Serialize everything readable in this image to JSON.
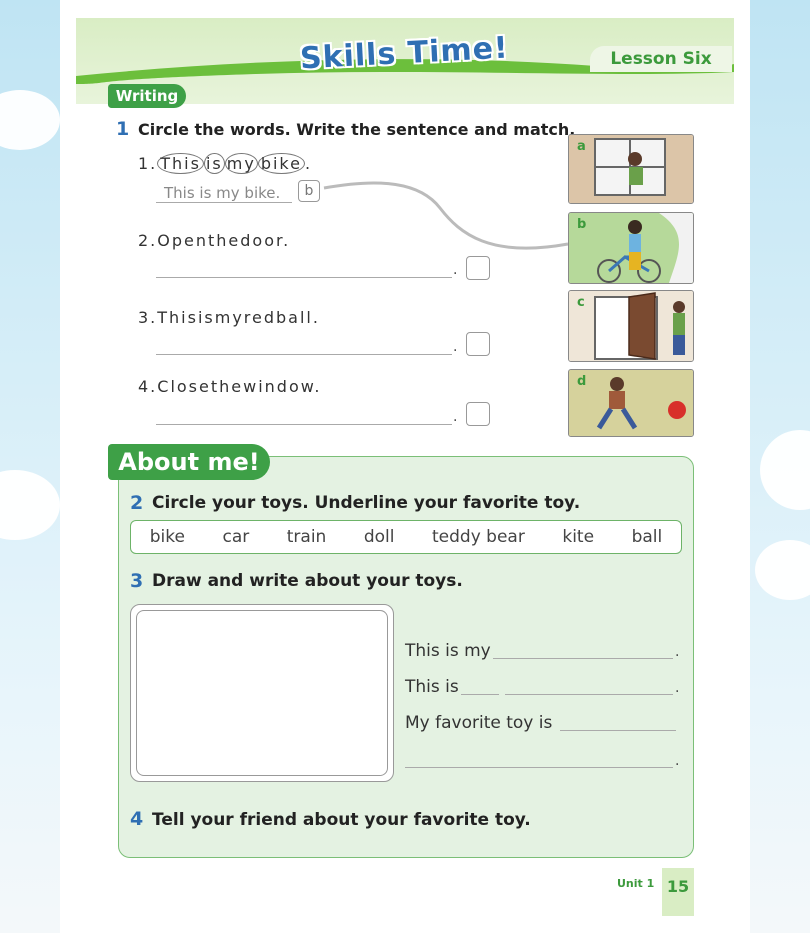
{
  "header": {
    "title": "Skills Time!",
    "lesson": "Lesson Six",
    "section_badge": "Writing"
  },
  "q1": {
    "number": "1",
    "instruction": "Circle the words. Write the sentence and match.",
    "items": [
      {
        "num": "1.",
        "words": [
          "This",
          "is",
          "my",
          "bike"
        ],
        "end": ".",
        "answer": "This is my bike.",
        "match": "b"
      },
      {
        "num": "2.",
        "text": "Openthedoor."
      },
      {
        "num": "3.",
        "text": "Thisismyredball."
      },
      {
        "num": "4.",
        "text": "Closethewindow."
      }
    ],
    "pictures": [
      "a",
      "b",
      "c",
      "d"
    ]
  },
  "about": {
    "badge": "About me!"
  },
  "q2": {
    "number": "2",
    "instruction": "Circle your toys. Underline your favorite toy.",
    "toys": [
      "bike",
      "car",
      "train",
      "doll",
      "teddy bear",
      "kite",
      "ball"
    ]
  },
  "q3": {
    "number": "3",
    "instruction": "Draw and write about your toys.",
    "sentences": [
      "This is my",
      "This is",
      "My favorite toy is"
    ]
  },
  "q4": {
    "number": "4",
    "instruction": "Tell your friend about your favorite toy."
  },
  "footer": {
    "unit": "Unit 1",
    "page": "15"
  }
}
